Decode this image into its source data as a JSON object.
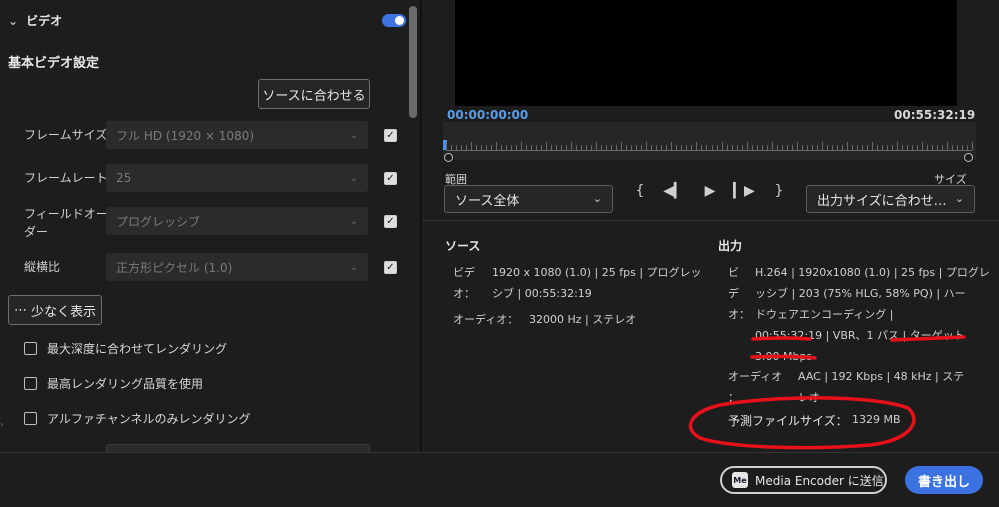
{
  "left": {
    "section_title": "ビデオ",
    "subsection_title": "基本ビデオ設定",
    "match_source_button": "ソースに合わせる",
    "rows": [
      {
        "label": "フレームサイズ",
        "value": "フル HD (1920 × 1080)"
      },
      {
        "label": "フレームレート",
        "value": "25"
      },
      {
        "label_line1": "フィールドオー",
        "label_line2": "ダー",
        "value": "プログレッシブ"
      },
      {
        "label": "縦横比",
        "value": "正方形ピクセル (1.0)"
      }
    ],
    "show_less_button": "少なく表示",
    "checkboxes": [
      {
        "label": "最大深度に合わせてレンダリング"
      },
      {
        "label": "最高レンダリング品質を使用"
      },
      {
        "label": "アルファチャンネルのみレンダリング"
      }
    ]
  },
  "preview": {
    "timecode_start": "00:00:00:00",
    "timecode_end": "00:55:32:19",
    "range_label": "範囲",
    "range_value": "ソース全体",
    "size_label": "サイズ",
    "size_value": "出力サイズに合わせ…"
  },
  "source": {
    "title": "ソース",
    "video_key_1": "ビデ",
    "video_key_2": "オ：",
    "video_line1": "1920 x 1080 (1.0) | 25 fps | プログレッ",
    "video_line2": "シブ | 00:55:32:19",
    "audio_key": "オーディオ：",
    "audio_value": "32000 Hz | ステレオ"
  },
  "output": {
    "title": "出力",
    "video_key_1": "ビ",
    "video_key_2": "デ",
    "video_key_3": "オ：",
    "line1": "H.264 | 1920x1080 (1.0) | 25 fps | プログレ",
    "line2": "ッシブ | 203 (75% HLG, 58% PQ) | ハー",
    "line3": "ドウェアエンコーディング |",
    "line4_a": "00:55:32:19",
    "line4_b": " | VBR、1 パス | ",
    "line4_c": "ターゲット",
    "line5": "3.00 Mbps",
    "audio_key_1": "オーディオ",
    "audio_key_2": "：",
    "audio_value": "AAC | 192 Kbps | 48 kHz | ステ",
    "audio_value_2": "レオ",
    "filesize_label": "予測ファイルサイズ：",
    "filesize_value": "1329 MB"
  },
  "footer": {
    "me_badge": "Me",
    "send_to_me": "Media Encoder に送信",
    "export": "書き出し"
  },
  "colors": {
    "accent": "#3b71e0",
    "annotation": "#e8101a",
    "timecode_blue": "#5c9ee6"
  }
}
